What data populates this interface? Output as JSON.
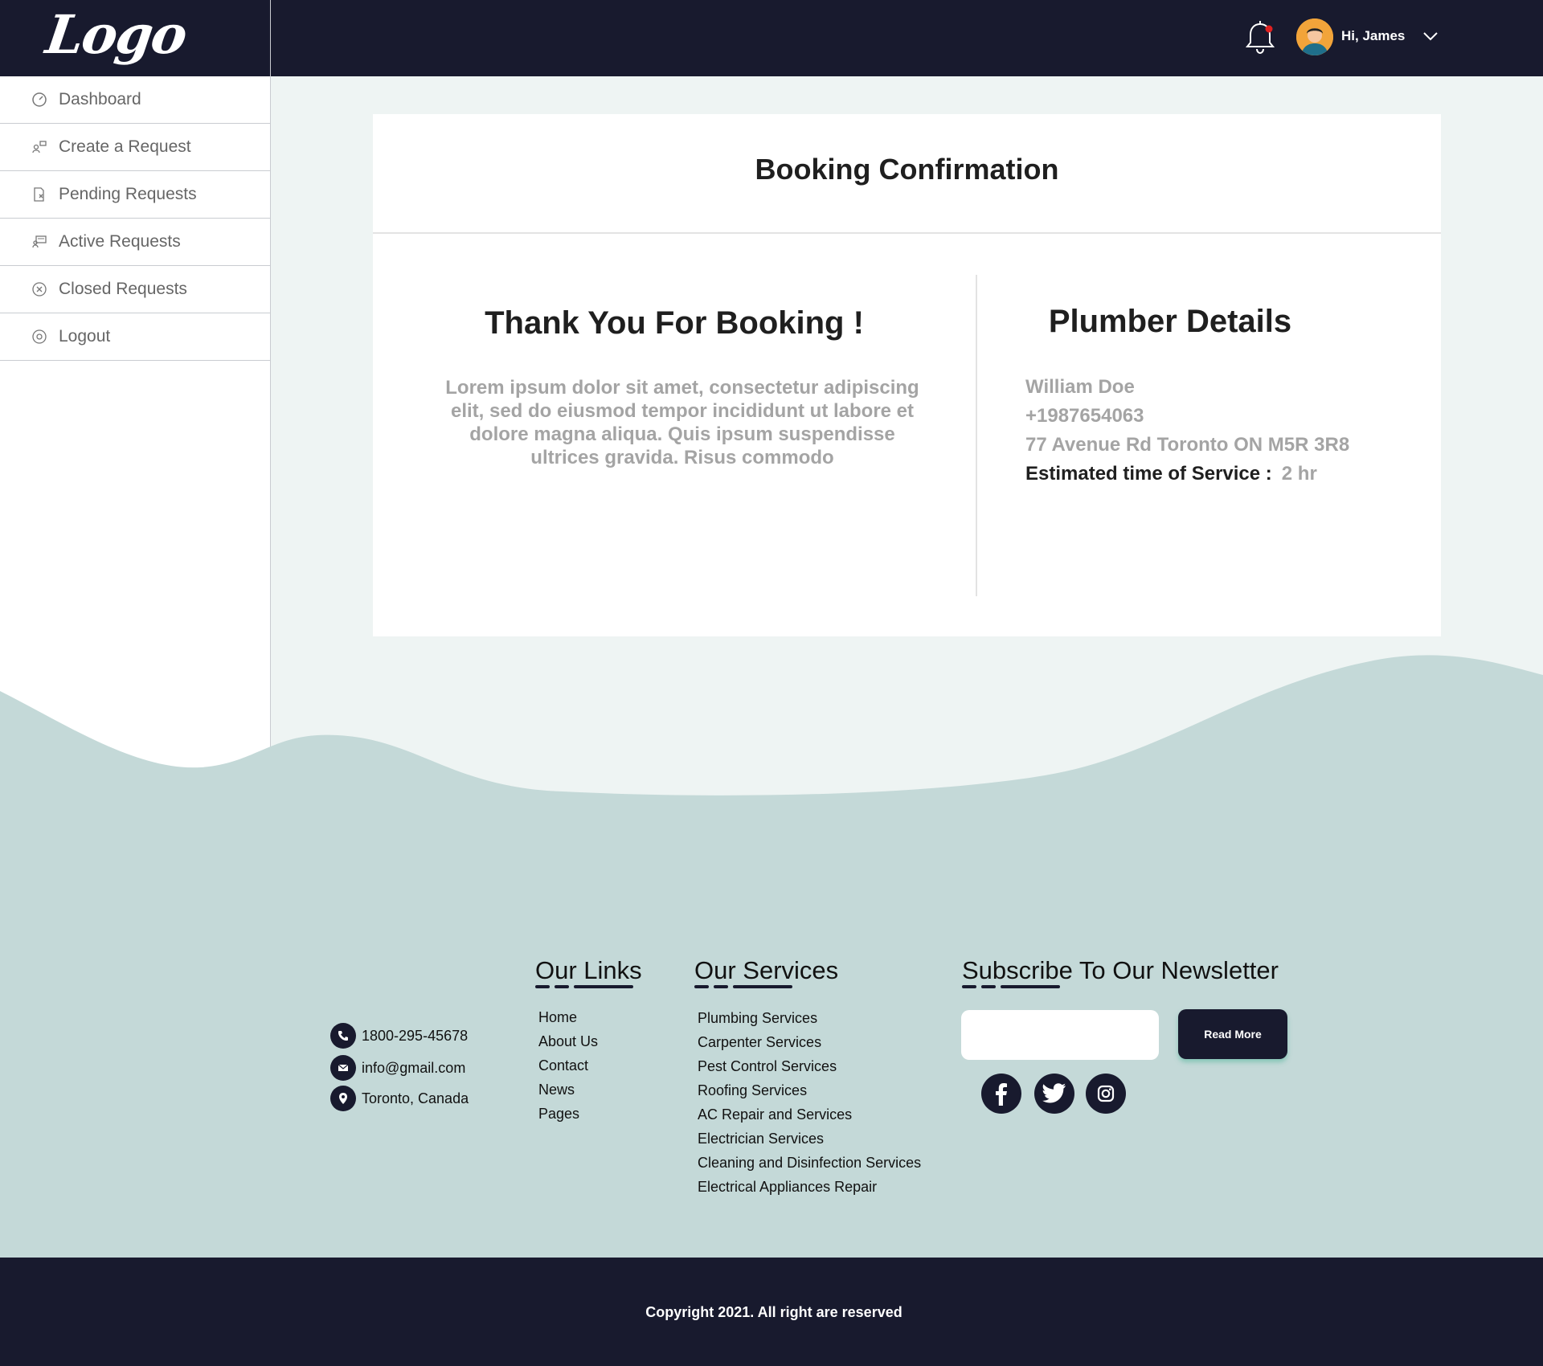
{
  "brand": {
    "logo_text": "Logo"
  },
  "header": {
    "greeting": "Hi, James",
    "notification_dot_color": "#e02020"
  },
  "sidebar": {
    "items": [
      {
        "label": "Dashboard",
        "icon": "gauge-icon"
      },
      {
        "label": "Create a Request",
        "icon": "create-request-icon"
      },
      {
        "label": "Pending Requests",
        "icon": "pending-document-icon"
      },
      {
        "label": "Active Requests",
        "icon": "active-requests-icon"
      },
      {
        "label": "Closed Requests",
        "icon": "closed-circle-icon"
      },
      {
        "label": "Logout",
        "icon": "logout-icon"
      }
    ]
  },
  "card": {
    "title": "Booking Confirmation",
    "thanks_heading": "Thank You For Booking !",
    "message": "Lorem ipsum dolor sit amet, consectetur adipiscing elit, sed do eiusmod tempor incididunt ut labore et dolore magna aliqua. Quis ipsum suspendisse ultrices gravida. Risus commodo",
    "plumber": {
      "heading": "Plumber Details",
      "name": "William Doe",
      "phone": "+1987654063",
      "address": "77 Avenue Rd Toronto ON M5R 3R8",
      "estimate_label": "Estimated time of Service :",
      "estimate_value": "2 hr"
    }
  },
  "footer": {
    "contact": {
      "phone": "1800-295-45678",
      "email": "info@gmail.com",
      "location": "Toronto, Canada"
    },
    "links": {
      "heading": "Our Links",
      "items": [
        "Home",
        "About Us",
        "Contact",
        "News",
        "Pages"
      ]
    },
    "services": {
      "heading": "Our Services",
      "items": [
        "Plumbing Services",
        "Carpenter Services",
        "Pest Control Services",
        "Roofing Services",
        "AC Repair and Services",
        "Electrician Services",
        "Cleaning and Disinfection Services",
        "Electrical Appliances Repair"
      ]
    },
    "newsletter": {
      "heading": "Subscribe To Our Newsletter",
      "input_value": "",
      "button_label": "Read More"
    },
    "social": [
      "facebook-icon",
      "twitter-icon",
      "instagram-icon"
    ],
    "copyright": "Copyright 2021. All right are reserved"
  },
  "colors": {
    "navy": "#181a2e",
    "page_bg": "#eef4f3",
    "footer_bg": "#c4d9d8",
    "muted_text": "#a4a4a4"
  }
}
